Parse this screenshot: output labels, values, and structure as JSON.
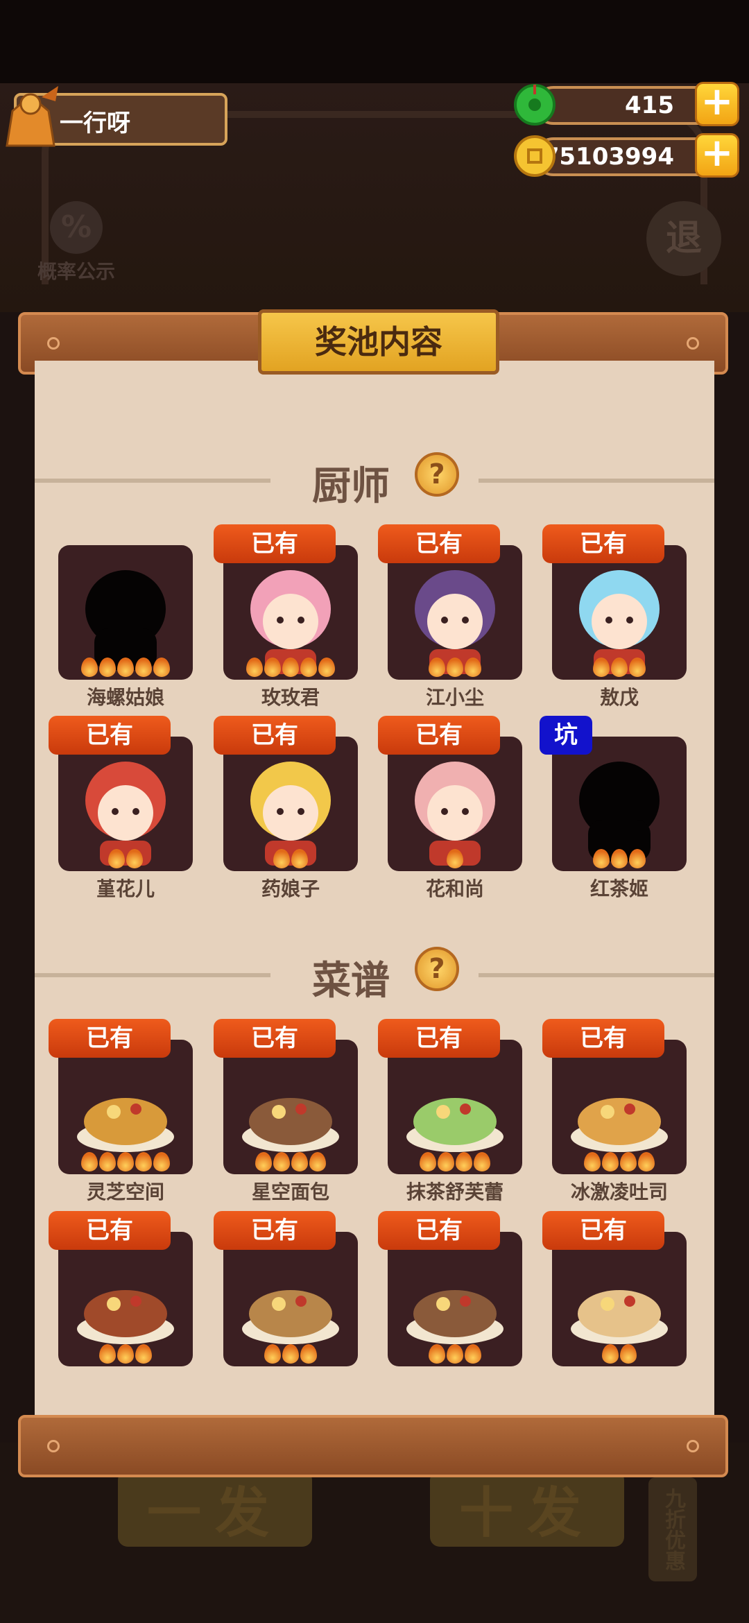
{
  "hud": {
    "player_name": "一行呀",
    "jade_amount": "415",
    "coin_amount": "75103994",
    "plus_label": "+",
    "probability_label": "概率公示",
    "probability_icon": "%",
    "exit_label": "退"
  },
  "dialog": {
    "title": "奖池内容",
    "help_icon": "?",
    "owned_badge": "已有",
    "pit_badge": "坑",
    "chef_section": {
      "title": "厨师",
      "items": [
        {
          "name": "海螺姑娘",
          "owned": false,
          "stars": 5,
          "silhouette": true,
          "badge": ""
        },
        {
          "name": "玫玫君",
          "owned": true,
          "stars": 5,
          "silhouette": false,
          "badge": "已有"
        },
        {
          "name": "江小尘",
          "owned": true,
          "stars": 3,
          "silhouette": false,
          "badge": "已有"
        },
        {
          "name": "敖戊",
          "owned": true,
          "stars": 3,
          "silhouette": false,
          "badge": "已有"
        },
        {
          "name": "堇花儿",
          "owned": true,
          "stars": 2,
          "silhouette": false,
          "badge": "已有"
        },
        {
          "name": "药娘子",
          "owned": true,
          "stars": 2,
          "silhouette": false,
          "badge": "已有"
        },
        {
          "name": "花和尚",
          "owned": true,
          "stars": 1,
          "silhouette": false,
          "badge": "已有"
        },
        {
          "name": "红茶姬",
          "owned": false,
          "stars": 3,
          "silhouette": true,
          "badge": "坑"
        }
      ]
    },
    "recipe_section": {
      "title": "菜谱",
      "items": [
        {
          "name": "灵芝空间",
          "owned": true,
          "stars": 5,
          "badge": "已有"
        },
        {
          "name": "星空面包",
          "owned": true,
          "stars": 4,
          "badge": "已有"
        },
        {
          "name": "抹茶舒芙蕾",
          "owned": true,
          "stars": 4,
          "badge": "已有"
        },
        {
          "name": "冰激凌吐司",
          "owned": true,
          "stars": 4,
          "badge": "已有"
        },
        {
          "name": "",
          "owned": true,
          "stars": 3,
          "badge": "已有"
        },
        {
          "name": "",
          "owned": true,
          "stars": 3,
          "badge": "已有"
        },
        {
          "name": "",
          "owned": true,
          "stars": 3,
          "badge": "已有"
        },
        {
          "name": "",
          "owned": true,
          "stars": 2,
          "badge": "已有"
        }
      ]
    }
  },
  "background_buttons": {
    "single_draw": "一发",
    "ten_draw": "十发",
    "discount_label": "九折优惠"
  },
  "colors": {
    "owned_badge": "#e04a14",
    "pit_badge": "#1212cc",
    "card_bg": "#3b1f22",
    "panel_bg": "#e6d2bd"
  }
}
